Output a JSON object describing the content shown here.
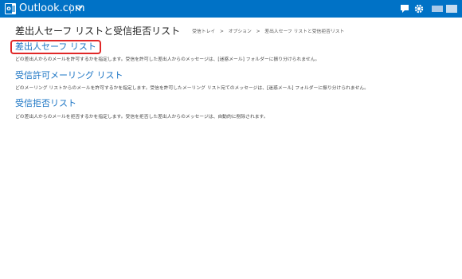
{
  "app": {
    "brand": "Outlook.com",
    "icons": [
      "outlook-logo-icon",
      "chevron-down-icon",
      "chat-icon",
      "gear-icon"
    ],
    "accent": "#0072c6"
  },
  "header": {
    "title": "差出人セーフ リストと受信拒否リスト",
    "breadcrumb": [
      "受信トレイ",
      "オプション",
      "差出人セーフ リストと受信拒否リスト"
    ],
    "breadcrumb_separator": ">"
  },
  "sections": [
    {
      "title": "差出人セーフ リスト",
      "description": "どの差出人からのメールを許可するかを指定します。受信を許可した差出人からのメッセージは、[迷惑メール] フォルダーに振り分けられません。",
      "highlighted": true
    },
    {
      "title": "受信許可メーリング リスト",
      "description": "どのメーリング リストからのメールを許可するかを指定します。受信を許可したメーリング リスト宛てのメッセージは、[迷惑メール] フォルダーに振り分けられません。",
      "highlighted": false
    },
    {
      "title": "受信拒否リスト",
      "description": "どの差出人からのメールを拒否するかを指定します。受信を拒否した差出人からのメッセージは、自動的に削除されます。",
      "highlighted": false
    }
  ],
  "colors": {
    "link": "#1a74c4",
    "highlight_border": "#e02828"
  }
}
